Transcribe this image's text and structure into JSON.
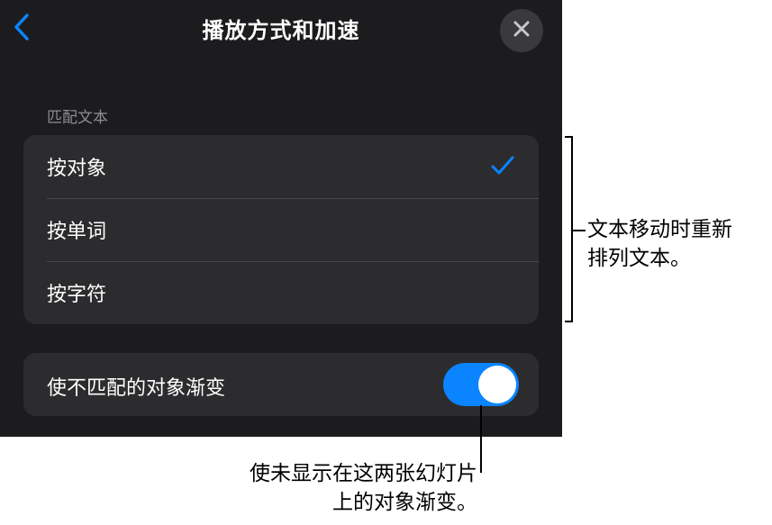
{
  "header": {
    "title": "播放方式和加速",
    "back_icon": "chevron-left-icon",
    "close_icon": "close-icon"
  },
  "match_text": {
    "section_label": "匹配文本",
    "options": [
      {
        "label": "按对象",
        "selected": true
      },
      {
        "label": "按单词",
        "selected": false
      },
      {
        "label": "按字符",
        "selected": false
      }
    ]
  },
  "fade": {
    "label": "使不匹配的对象渐变",
    "enabled": true
  },
  "callouts": {
    "right_line1": "文本移动时重新",
    "right_line2": "排列文本。",
    "bottom_line1": "使未显示在这两张幻灯片",
    "bottom_line2": "上的对象渐变。"
  },
  "colors": {
    "panel_bg": "#1c1c1e",
    "group_bg": "#2c2c2e",
    "accent": "#0a84ff",
    "secondary_text": "#8d8d92"
  }
}
